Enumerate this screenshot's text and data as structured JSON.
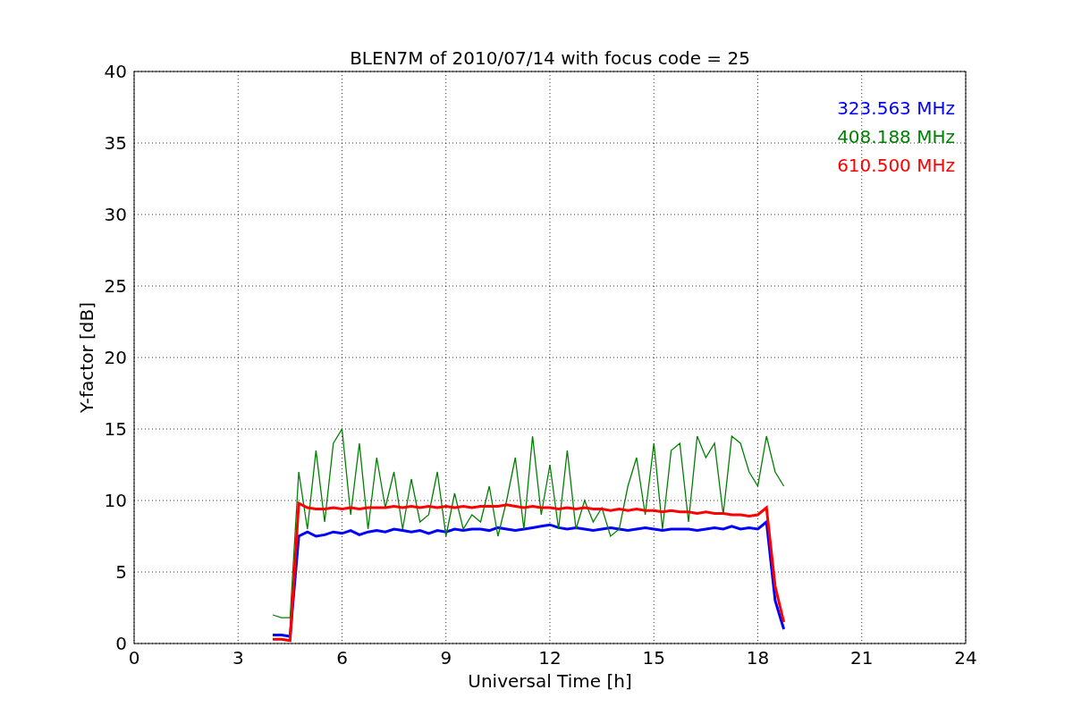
{
  "figure": {
    "chart_data": {
      "type": "line",
      "title": "BLEN7M of 2010/07/14 with focus code = 25",
      "xlabel": "Universal Time [h]",
      "ylabel": "Y-factor [dB]",
      "x": [
        4.0,
        4.25,
        4.5,
        4.75,
        5.0,
        5.25,
        5.5,
        5.75,
        6.0,
        6.25,
        6.5,
        6.75,
        7.0,
        7.25,
        7.5,
        7.75,
        8.0,
        8.25,
        8.5,
        8.75,
        9.0,
        9.25,
        9.5,
        9.75,
        10.0,
        10.25,
        10.5,
        10.75,
        11.0,
        11.25,
        11.5,
        11.75,
        12.0,
        12.25,
        12.5,
        12.75,
        13.0,
        13.25,
        13.5,
        13.75,
        14.0,
        14.25,
        14.5,
        14.75,
        15.0,
        15.25,
        15.5,
        15.75,
        16.0,
        16.25,
        16.5,
        16.75,
        17.0,
        17.25,
        17.5,
        17.75,
        18.0,
        18.25,
        18.5,
        18.75
      ],
      "series": [
        {
          "name": "323.563 MHz",
          "color": "#0000ff",
          "values": [
            0.6,
            0.6,
            0.5,
            7.5,
            7.8,
            7.5,
            7.6,
            7.8,
            7.7,
            7.9,
            7.6,
            7.8,
            7.9,
            7.8,
            8.0,
            7.9,
            7.8,
            7.9,
            7.7,
            7.9,
            7.8,
            8.0,
            7.9,
            8.0,
            8.0,
            7.9,
            8.1,
            8.0,
            7.9,
            8.0,
            8.1,
            8.2,
            8.3,
            8.1,
            8.0,
            8.1,
            8.0,
            7.9,
            8.0,
            8.1,
            8.0,
            7.9,
            8.0,
            8.1,
            8.0,
            7.9,
            8.0,
            8.0,
            8.0,
            7.9,
            8.0,
            8.1,
            8.0,
            8.2,
            8.0,
            8.1,
            8.0,
            8.5,
            3.0,
            1.0
          ]
        },
        {
          "name": "408.188 MHz",
          "color": "#008000",
          "values": [
            2.0,
            1.8,
            1.8,
            12.0,
            8.0,
            13.5,
            8.5,
            14.0,
            15.0,
            9.0,
            14.0,
            8.0,
            13.0,
            9.5,
            12.0,
            8.0,
            11.5,
            8.5,
            9.0,
            12.0,
            7.5,
            10.5,
            8.0,
            9.0,
            8.5,
            11.0,
            7.5,
            10.0,
            13.0,
            8.0,
            14.5,
            9.0,
            12.5,
            8.0,
            13.5,
            8.0,
            10.0,
            8.5,
            9.5,
            7.5,
            8.0,
            11.0,
            13.0,
            9.0,
            14.0,
            8.0,
            13.5,
            14.0,
            8.5,
            14.5,
            13.0,
            14.0,
            9.0,
            14.5,
            14.0,
            12.0,
            11.0,
            14.5,
            12.0,
            11.0
          ]
        },
        {
          "name": "610.500 MHz",
          "color": "#ff0000",
          "values": [
            0.3,
            0.3,
            0.2,
            9.8,
            9.5,
            9.4,
            9.4,
            9.5,
            9.4,
            9.5,
            9.4,
            9.5,
            9.5,
            9.5,
            9.6,
            9.5,
            9.6,
            9.5,
            9.6,
            9.5,
            9.6,
            9.5,
            9.6,
            9.5,
            9.6,
            9.6,
            9.6,
            9.7,
            9.6,
            9.5,
            9.6,
            9.5,
            9.5,
            9.4,
            9.5,
            9.4,
            9.5,
            9.4,
            9.4,
            9.3,
            9.4,
            9.3,
            9.4,
            9.3,
            9.3,
            9.2,
            9.3,
            9.2,
            9.2,
            9.1,
            9.2,
            9.1,
            9.1,
            9.0,
            9.0,
            8.9,
            9.0,
            9.5,
            4.0,
            1.5
          ]
        }
      ],
      "grid": true,
      "xlim": [
        0,
        24
      ],
      "ylim": [
        0,
        40
      ],
      "xticks": [
        0,
        3,
        6,
        9,
        12,
        15,
        18,
        21,
        24
      ],
      "yticks": [
        0,
        5,
        10,
        15,
        20,
        25,
        30,
        35,
        40
      ]
    }
  }
}
